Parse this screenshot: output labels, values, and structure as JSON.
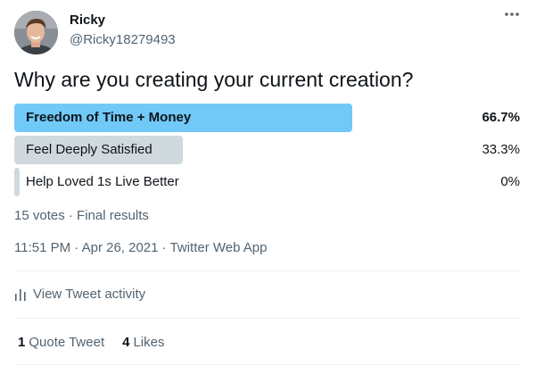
{
  "user": {
    "name": "Ricky",
    "handle": "@Ricky18279493"
  },
  "menu_icon": "more-horizontal-icon",
  "poll": {
    "question": "Why are you creating your current creation?",
    "options": [
      {
        "label": "Freedom of Time + Money",
        "percent": "66.7%",
        "fraction": 0.667,
        "winner": true
      },
      {
        "label": "Feel Deeply Satisfied",
        "percent": "33.3%",
        "fraction": 0.333,
        "winner": false
      },
      {
        "label": "Help Loved 1s Live Better",
        "percent": "0%",
        "fraction": 0.0,
        "winner": false
      }
    ],
    "summary": "15 votes · Final results"
  },
  "timestamp": "11:51 PM · Apr 26, 2021 · Twitter Web App",
  "activity": {
    "label": "View Tweet activity",
    "icon": "analytics-icon"
  },
  "stats": {
    "quote_tweets": {
      "count": "1",
      "label": "Quote Tweet"
    },
    "likes": {
      "count": "4",
      "label": "Likes"
    }
  },
  "colors": {
    "winner_bar": "#71c9f8",
    "other_bar": "#cfd9de",
    "secondary_text": "#536471"
  }
}
